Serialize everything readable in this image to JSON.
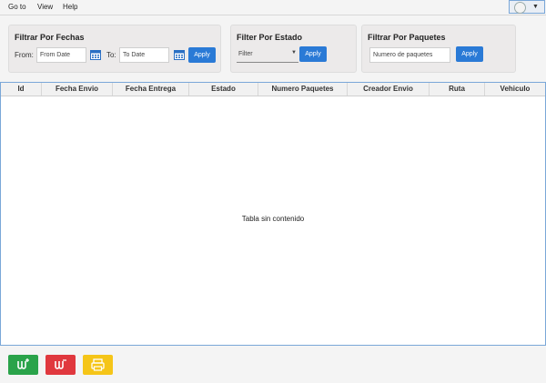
{
  "menu": {
    "items": [
      "Go to",
      "View",
      "Help"
    ]
  },
  "user": {
    "icon": "user-avatar-icon"
  },
  "filters": {
    "dates": {
      "title": "Filtrar Por Fechas",
      "from_label": "From:",
      "from_placeholder": "From Date",
      "to_label": "To:",
      "to_placeholder": "To Date",
      "apply": "Apply"
    },
    "estado": {
      "title": "Filter Por Estado",
      "select_value": "Filter",
      "apply": "Apply"
    },
    "paquetes": {
      "title": "Filtrar Por Paquetes",
      "placeholder": "Numero de paquetes",
      "apply": "Apply"
    }
  },
  "table": {
    "columns": [
      "Id",
      "Fecha Envio",
      "Fecha Entrega",
      "Estado",
      "Numero Paquetes",
      "Creador Envio",
      "Ruta",
      "Vehiculo"
    ],
    "empty_text": "Tabla sin contenido"
  },
  "actions": [
    {
      "name": "add-envio-button",
      "icon": "add-user-icon",
      "color": "#2aa34a"
    },
    {
      "name": "remove-envio-button",
      "icon": "remove-user-icon",
      "color": "#e0383e"
    },
    {
      "name": "print-button",
      "icon": "printer-icon",
      "color": "#f5c518"
    }
  ],
  "colors": {
    "accent": "#2a7ad6",
    "border_focus": "#7aa7d8"
  }
}
